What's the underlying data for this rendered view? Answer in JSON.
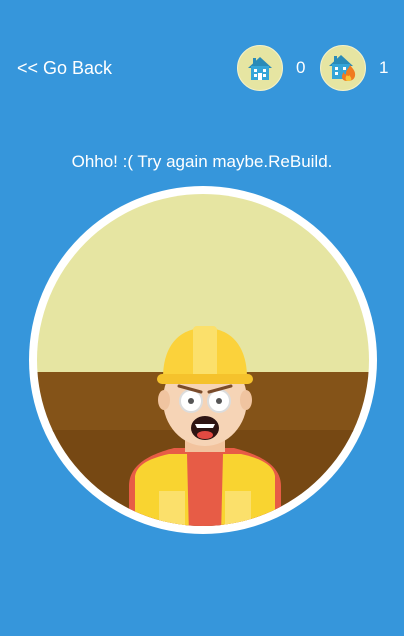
{
  "nav": {
    "back_label": "<< Go Back"
  },
  "counters": {
    "built": {
      "icon": "house-icon",
      "value": "0"
    },
    "burned": {
      "icon": "burning-house-icon",
      "value": "1"
    }
  },
  "status": {
    "message": "Ohho! :( Try again maybe.ReBuild."
  },
  "scene": {
    "icon": "shocked-builder-illustration"
  },
  "colors": {
    "background": "#3696db",
    "badge": "#e6e5a2",
    "house": "#35a5d8",
    "wall": "#e6e5a2",
    "floor": "#845318",
    "helmet": "#fbd23b",
    "vest": "#f9d430",
    "shirt": "#e75c46"
  }
}
